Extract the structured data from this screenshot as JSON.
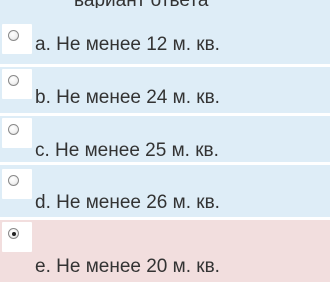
{
  "question": {
    "clipped_text": "вариант ответа"
  },
  "answers": [
    {
      "label": "a. Не менее 12 м. кв.",
      "checked": false
    },
    {
      "label": "b. Не менее 24 м. кв.",
      "checked": false
    },
    {
      "label": "c. Не менее 25 м. кв.",
      "checked": false
    },
    {
      "label": "d. Не менее 26 м. кв.",
      "checked": false
    },
    {
      "label": "e. Не менее 20 м. кв.",
      "checked": true
    }
  ],
  "colors": {
    "unselected_bg": "#deedf7",
    "selected_bg": "#f2dede",
    "text": "#333333"
  }
}
